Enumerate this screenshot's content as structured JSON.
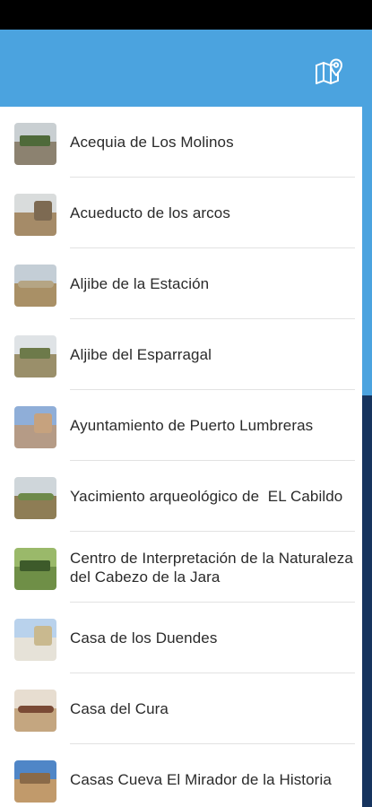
{
  "app_bar": {
    "color": "#4ba3df",
    "action_icon": "map-pin-icon"
  },
  "places": [
    {
      "name": "Acequia de Los Molinos",
      "thumb": {
        "sky": "#c9cfd2",
        "ground": "#8c8270",
        "feature": "#4f6a3a"
      }
    },
    {
      "name": "Acueducto de los arcos",
      "thumb": {
        "sky": "#d9dcdc",
        "ground": "#a58b68",
        "feature": "#7d6a52"
      }
    },
    {
      "name": "Aljibe de la Estación",
      "thumb": {
        "sky": "#c4ced6",
        "ground": "#a99066",
        "feature": "#b5a584"
      }
    },
    {
      "name": "Aljibe del Esparragal",
      "thumb": {
        "sky": "#dfe3e6",
        "ground": "#9a8f6a",
        "feature": "#6d7a4a"
      }
    },
    {
      "name": "Ayuntamiento de Puerto Lumbreras",
      "thumb": {
        "sky": "#8faed8",
        "ground": "#b59b86",
        "feature": "#c6a27e"
      }
    },
    {
      "name": "Yacimiento arqueológico de  EL Cabildo",
      "thumb": {
        "sky": "#cfd6da",
        "ground": "#8e7d55",
        "feature": "#6e8a4a"
      }
    },
    {
      "name": "Centro de Interpretación de la Naturaleza del Cabezo de la Jara",
      "thumb": {
        "sky": "#9ab96a",
        "ground": "#6f8f47",
        "feature": "#3d5a2a"
      }
    },
    {
      "name": "Casa de los Duendes",
      "thumb": {
        "sky": "#b9d2ec",
        "ground": "#e6e2d8",
        "feature": "#c9b98f"
      }
    },
    {
      "name": "Casa del Cura",
      "thumb": {
        "sky": "#e7ddd0",
        "ground": "#c4a680",
        "feature": "#7a4a35"
      }
    },
    {
      "name": "Casas Cueva El Mirador de la Historia",
      "thumb": {
        "sky": "#4f86c7",
        "ground": "#c19a6b",
        "feature": "#8a6a48"
      }
    }
  ],
  "scrollbar": {
    "track_color": "#16345e",
    "thumb_color": "#4ba3df",
    "position": 0
  }
}
